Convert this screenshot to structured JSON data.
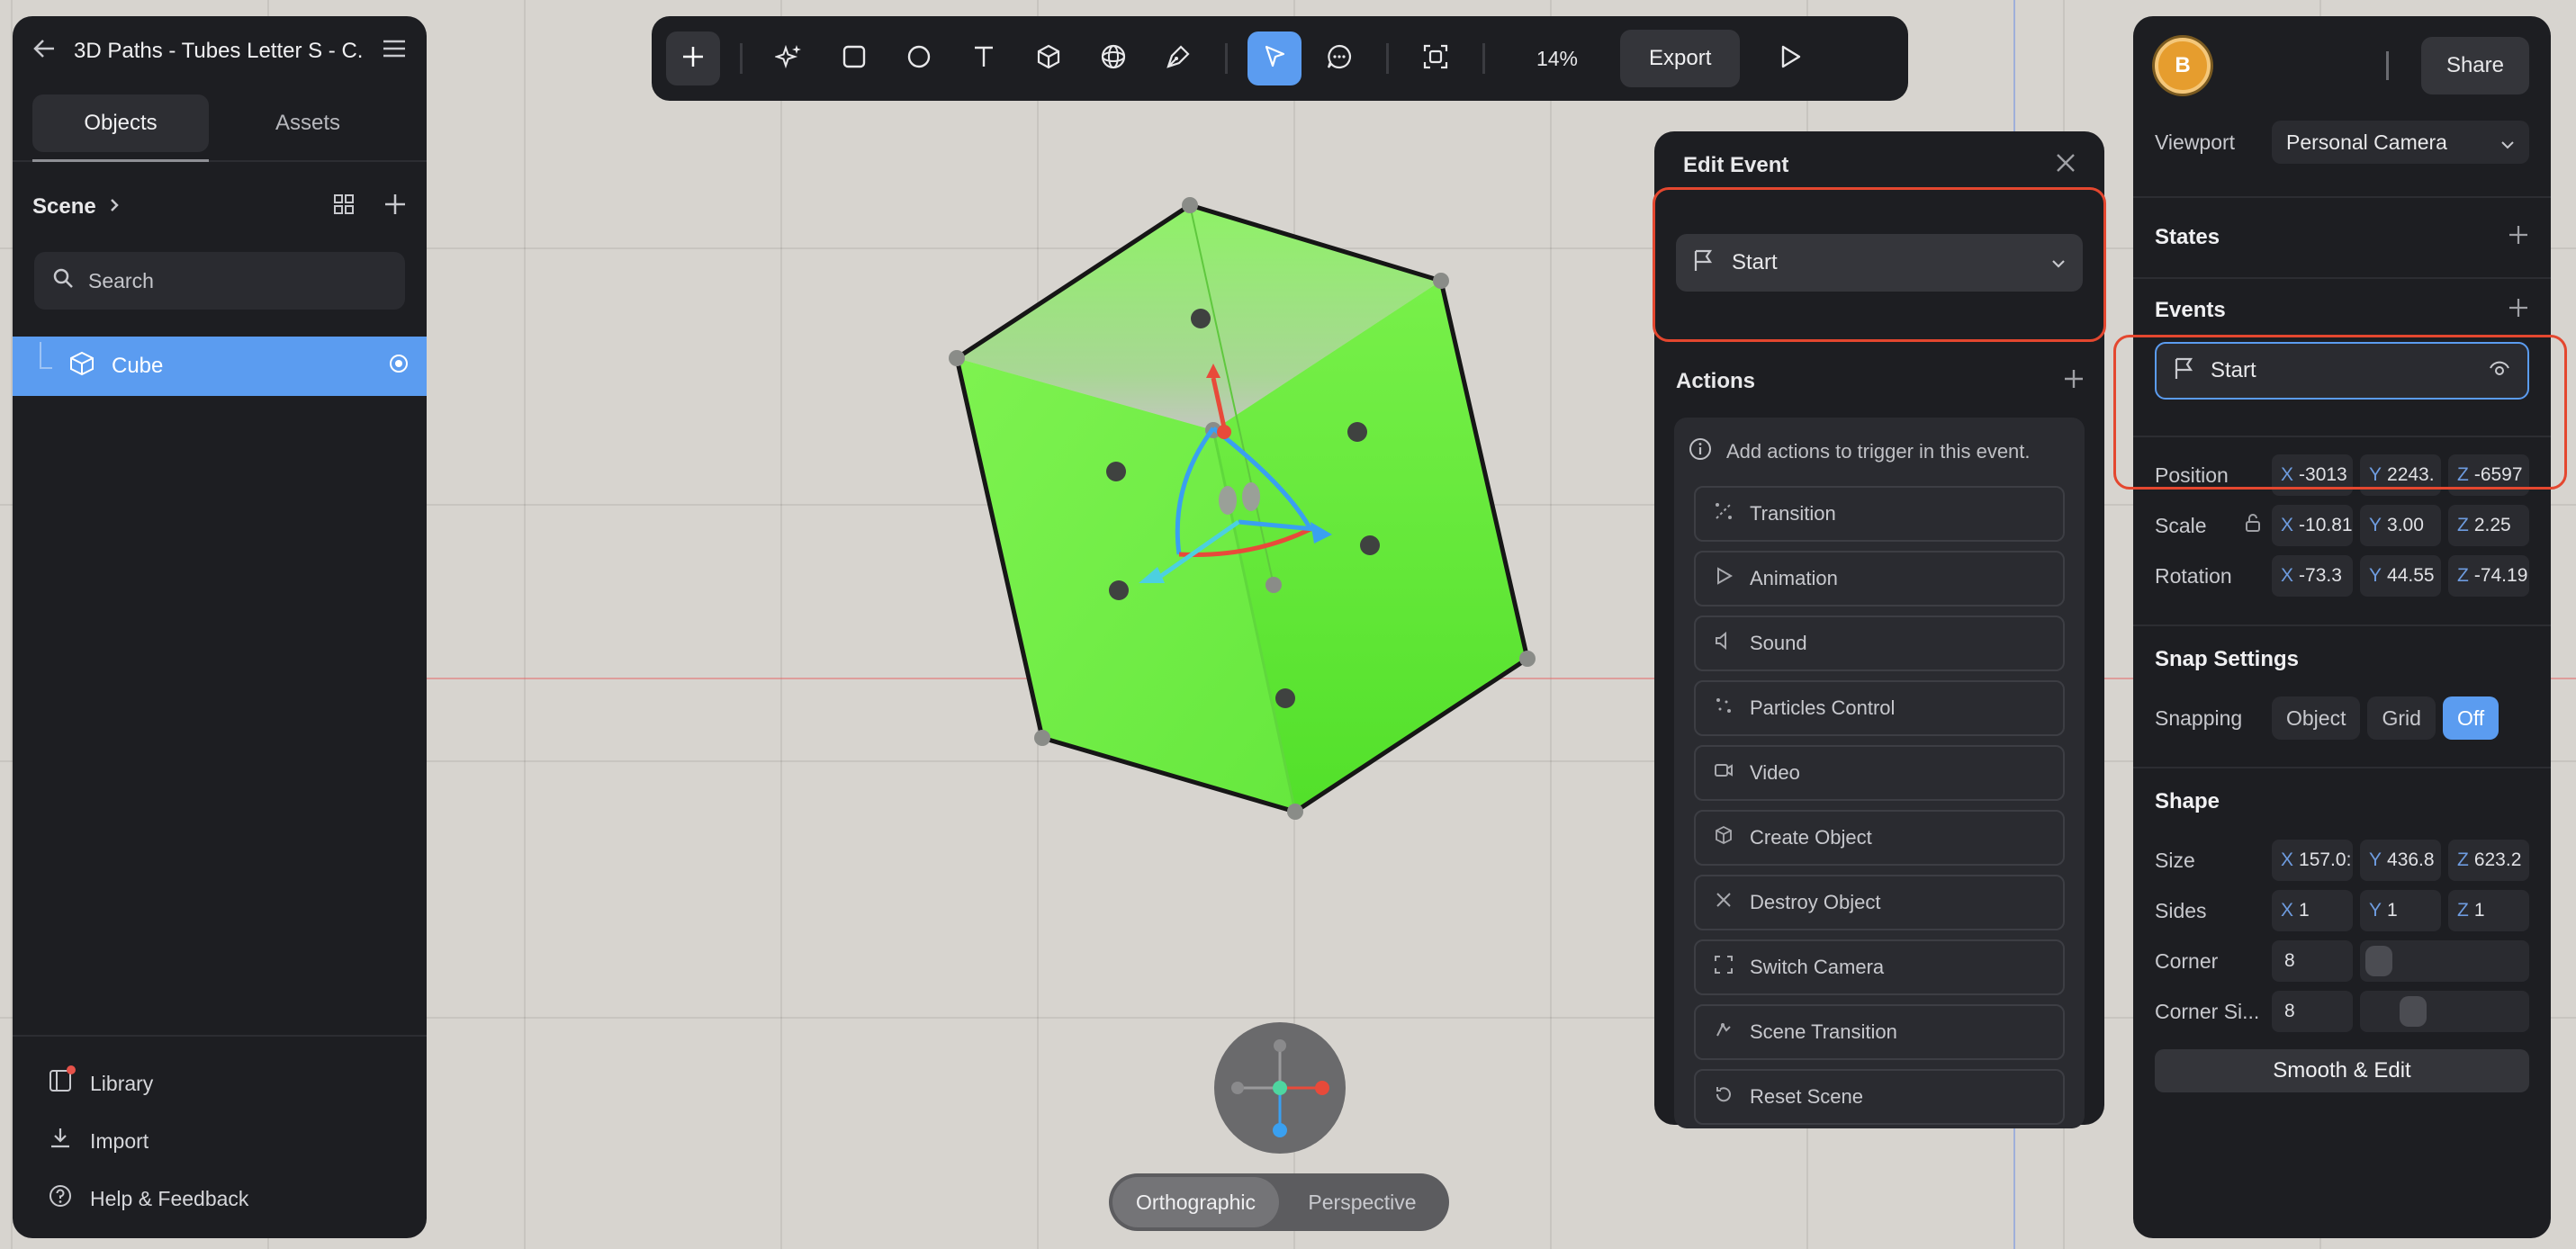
{
  "project": {
    "title": "3D Paths - Tubes Letter S - C..."
  },
  "left_panel": {
    "tabs": [
      {
        "label": "Objects"
      },
      {
        "label": "Assets"
      }
    ],
    "scene_label": "Scene",
    "search_placeholder": "Search",
    "objects": [
      {
        "name": "Cube",
        "icon": "cube-icon",
        "selected": true
      }
    ],
    "bottom": [
      {
        "label": "Library",
        "icon": "library-icon"
      },
      {
        "label": "Import",
        "icon": "import-icon"
      },
      {
        "label": "Help & Feedback",
        "icon": "help-icon"
      }
    ]
  },
  "toolbar": {
    "tools": [
      "add-icon",
      "ai-sparkle-icon",
      "rectangle-icon",
      "ellipse-icon",
      "text-icon",
      "cube-icon",
      "sphere-icon",
      "pen-icon",
      "select-arrow-icon",
      "comment-icon",
      "frame-icon"
    ],
    "zoom": "14%",
    "export_label": "Export",
    "play_icon": "play-icon"
  },
  "edit_event": {
    "title": "Edit Event",
    "trigger": "Start",
    "actions_label": "Actions",
    "info": "Add actions to trigger in this event.",
    "actions": [
      {
        "label": "Transition",
        "icon": "transition-icon"
      },
      {
        "label": "Animation",
        "icon": "animation-icon"
      },
      {
        "label": "Sound",
        "icon": "sound-icon"
      },
      {
        "label": "Particles Control",
        "icon": "particles-icon"
      },
      {
        "label": "Video",
        "icon": "video-icon"
      },
      {
        "label": "Create Object",
        "icon": "create-object-icon"
      },
      {
        "label": "Destroy Object",
        "icon": "destroy-object-icon"
      },
      {
        "label": "Switch Camera",
        "icon": "switch-camera-icon"
      },
      {
        "label": "Scene Transition",
        "icon": "scene-transition-icon"
      },
      {
        "label": "Reset Scene",
        "icon": "reset-scene-icon"
      }
    ]
  },
  "right_panel": {
    "avatar_initial": "B",
    "share_label": "Share",
    "viewport_label": "Viewport",
    "viewport_value": "Personal Camera",
    "states_label": "States",
    "events_label": "Events",
    "event_item": "Start",
    "position": {
      "label": "Position",
      "x": "-3013",
      "y": "2243.",
      "z": "-6597"
    },
    "scale": {
      "label": "Scale",
      "x": "-10.81",
      "y": "3.00",
      "z": "2.25"
    },
    "rotation": {
      "label": "Rotation",
      "x": "-73.3",
      "y": "44.55",
      "z": "-74.19"
    },
    "snap_settings_label": "Snap Settings",
    "snapping_label": "Snapping",
    "snapping_options": [
      "Object",
      "Grid",
      "Off"
    ],
    "snapping_selected": "Off",
    "shape_label": "Shape",
    "size": {
      "label": "Size",
      "x": "157.0:",
      "y": "436.8",
      "z": "623.2"
    },
    "sides": {
      "label": "Sides",
      "x": "1",
      "y": "1",
      "z": "1"
    },
    "corner": {
      "label": "Corner",
      "value": "8"
    },
    "corner_sides": {
      "label": "Corner Si...",
      "value": "8"
    },
    "smooth_label": "Smooth & Edit"
  },
  "view_toggle": {
    "options": [
      "Orthographic",
      "Perspective"
    ],
    "selected": "Orthographic"
  },
  "colors": {
    "accent": "#5b9cf0",
    "highlight": "#e4472f",
    "cube": "#7cf050",
    "panel": "#1d1e22"
  }
}
